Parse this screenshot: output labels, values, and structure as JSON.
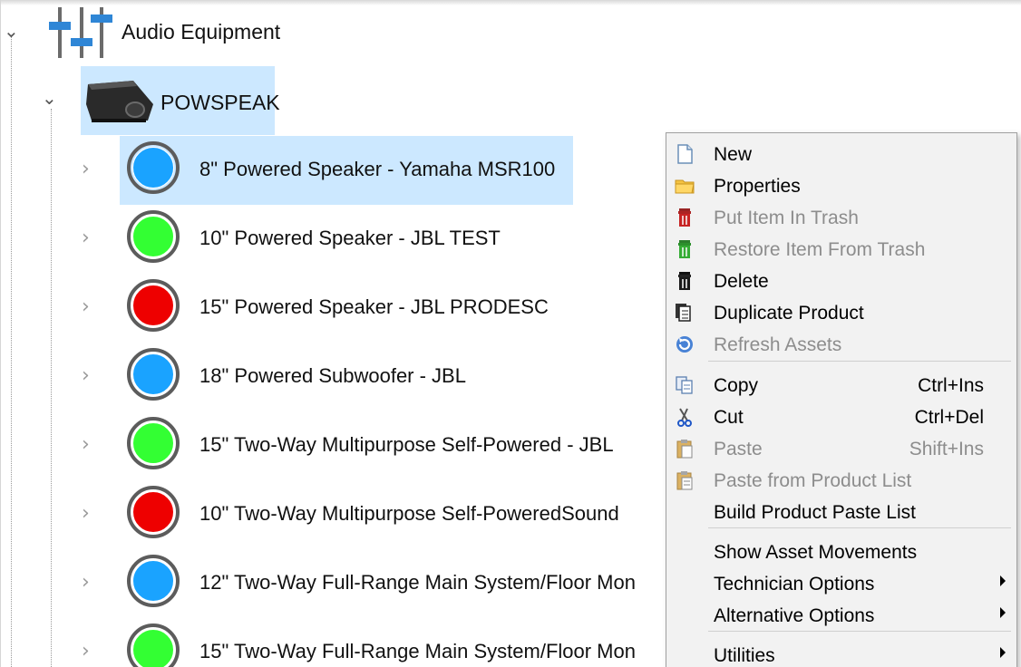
{
  "tree": {
    "root": {
      "label": "Audio Equipment",
      "icon": "mixer-sliders-icon"
    },
    "category": {
      "label": "POWSPEAK",
      "icon": "stage-monitor-speaker-icon"
    },
    "products": [
      {
        "label": "8\" Powered Speaker - Yamaha MSR100",
        "status_color": "#1aa3ff",
        "selected": true
      },
      {
        "label": "10\" Powered Speaker - JBL TEST",
        "status_color": "#33ff33",
        "selected": false
      },
      {
        "label": "15\" Powered Speaker - JBL PRODESC",
        "status_color": "#ee0000",
        "selected": false
      },
      {
        "label": "18\" Powered Subwoofer - JBL",
        "status_color": "#1aa3ff",
        "selected": false
      },
      {
        "label": "15\" Two-Way Multipurpose Self-Powered - JBL",
        "status_color": "#33ff33",
        "selected": false
      },
      {
        "label": "10\" Two-Way Multipurpose Self-PoweredSound",
        "status_color": "#ee0000",
        "selected": false
      },
      {
        "label": "12\" Two-Way Full-Range Main System/Floor Mon",
        "status_color": "#1aa3ff",
        "selected": false
      },
      {
        "label": "15\" Two-Way Full-Range Main System/Floor Mon",
        "status_color": "#33ff33",
        "selected": false
      }
    ]
  },
  "context_menu": {
    "items": [
      {
        "label": "New",
        "shortcut": "",
        "icon": "new-document-icon",
        "disabled": false
      },
      {
        "label": "Properties",
        "shortcut": "",
        "icon": "folder-icon",
        "disabled": false
      },
      {
        "label": "Put Item In Trash",
        "shortcut": "",
        "icon": "red-trash-icon",
        "disabled": true
      },
      {
        "label": "Restore Item From Trash",
        "shortcut": "",
        "icon": "green-trash-icon",
        "disabled": true
      },
      {
        "label": "Delete",
        "shortcut": "",
        "icon": "black-trash-icon",
        "disabled": false
      },
      {
        "label": "Duplicate Product",
        "shortcut": "",
        "icon": "duplicate-pages-icon",
        "disabled": false
      },
      {
        "label": "Refresh Assets",
        "shortcut": "",
        "icon": "refresh-icon",
        "disabled": true
      },
      {
        "label": "Copy",
        "shortcut": "Ctrl+Ins",
        "icon": "copy-icon",
        "disabled": false
      },
      {
        "label": "Cut",
        "shortcut": "Ctrl+Del",
        "icon": "scissors-icon",
        "disabled": false
      },
      {
        "label": "Paste",
        "shortcut": "Shift+Ins",
        "icon": "clipboard-icon",
        "disabled": true
      },
      {
        "label": "Paste from Product List",
        "shortcut": "",
        "icon": "clipboard-list-icon",
        "disabled": true
      },
      {
        "label": "Build Product Paste List",
        "shortcut": "",
        "icon": "",
        "disabled": false
      },
      {
        "label": "Show Asset Movements",
        "shortcut": "",
        "icon": "",
        "disabled": false
      },
      {
        "label": "Technician Options",
        "shortcut": "",
        "icon": "",
        "disabled": false,
        "submenu": true
      },
      {
        "label": "Alternative Options",
        "shortcut": "",
        "icon": "",
        "disabled": false,
        "submenu": true
      },
      {
        "label": "Utilities",
        "shortcut": "",
        "icon": "",
        "disabled": false,
        "submenu": true
      }
    ]
  }
}
